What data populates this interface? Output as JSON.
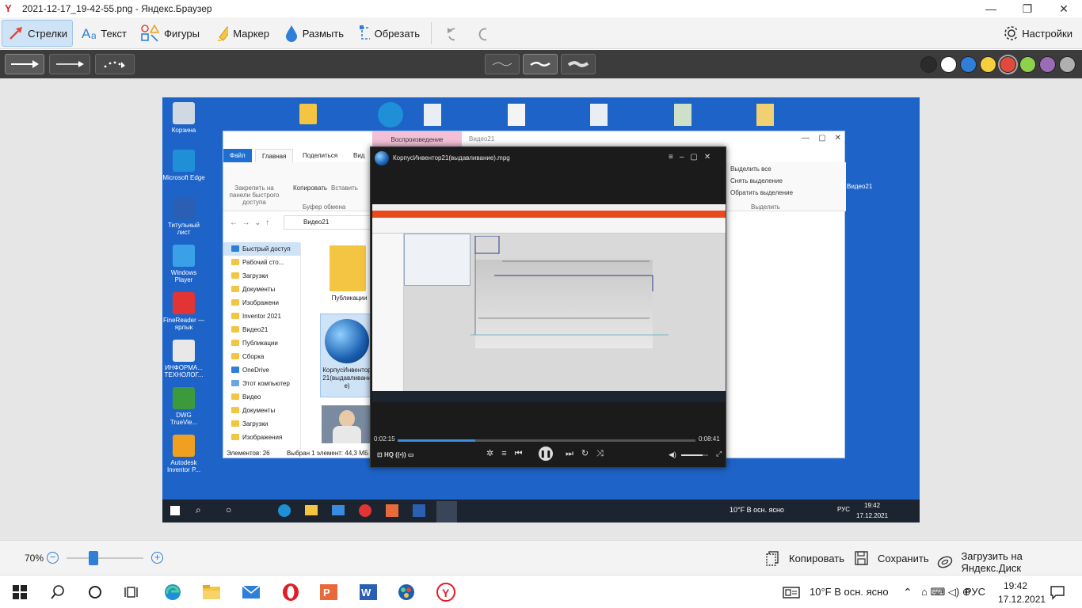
{
  "window": {
    "title": "2021-12-17_19-42-55.png - Яндекс.Браузер",
    "minimize": "—",
    "maximize": "❐",
    "close": "✕"
  },
  "toolbar": {
    "arrows": "Стрелки",
    "text": "Текст",
    "shapes": "Фигуры",
    "marker": "Маркер",
    "blur": "Размыть",
    "crop": "Обрезать",
    "settings": "Настройки"
  },
  "colors": {
    "palette": [
      "#2b2b2b",
      "#ffffff",
      "#2f7fd8",
      "#f4d03f",
      "#e0493c",
      "#8fd14f",
      "#9b6bb5",
      "#b0b0b0"
    ],
    "desktop_bg": "#1e64c8",
    "accent": "#3d8ce0"
  },
  "screenshot": {
    "desktop_icons": [
      {
        "label": "Корзина",
        "color": "#cfd8e3"
      },
      {
        "label": "Microsoft Edge",
        "color": "#1f8fd8"
      },
      {
        "label": "Титульный лист",
        "color": "#2b5fb4"
      },
      {
        "label": "Windows Player",
        "color": "#3aa0e8"
      },
      {
        "label": "FineReader — ярлык",
        "color": "#e23434"
      },
      {
        "label": "ИНФОРМА... ТЕХНОЛОГ...",
        "color": "#e8e8e8"
      },
      {
        "label": "DWG TrueVie...",
        "color": "#3c9a3c"
      },
      {
        "label": "Autodesk Inventor P...",
        "color": "#f0a020"
      }
    ],
    "explorer": {
      "tab_playback": "Воспроизведение",
      "title": "Видео21",
      "tab_file": "Файл",
      "tab_home": "Главная",
      "tab_share": "Поделиться",
      "tab_view": "Вид",
      "pin": "Закрепить на панели быстрого доступа",
      "copy": "Копировать",
      "paste": "Вставить",
      "clipboard": "Буфер обмена",
      "select_all": "Выделить все",
      "deselect": "Снять выделение",
      "invert": "Обратить выделение",
      "select_group": "Выделить",
      "address": "Видео21",
      "nav": [
        "Быстрый доступ",
        "Рабочий сто...",
        "Загрузки",
        "Документы",
        "Изображени",
        "Inventor 2021",
        "Видео21",
        "Публикации",
        "Сборка",
        "OneDrive",
        "Этот компьютер",
        "Видео",
        "Документы",
        "Загрузки",
        "Изображения"
      ],
      "folder_pub": "Публикации",
      "file_name": "КорпусИнвентор21(выдавливание)",
      "status_items": "Элементов: 26",
      "status_selected": "Выбран 1 элемент: 44,3 МБ",
      "right_item": "Видео21"
    },
    "player": {
      "title": "КорпусИнвентор21(выдавливание).mpg",
      "time_current": "0:02:15",
      "time_total": "0:08:41",
      "progress": 0.26,
      "hq": "HQ",
      "volume": 0.8
    },
    "inner_taskbar": {
      "weather": "10°F  В осн. ясно",
      "lang": "РУС",
      "time": "19:42",
      "date": "17.12.2021"
    }
  },
  "zoom": {
    "level": "70%",
    "value": 0.35
  },
  "actions": {
    "copy": "Копировать",
    "save": "Сохранить",
    "upload": "Загрузить на Яндекс.Диск"
  },
  "taskbar": {
    "weather": "10°F  В осн. ясно",
    "lang": "РУС",
    "time": "19:42",
    "date": "17.12.2021"
  }
}
